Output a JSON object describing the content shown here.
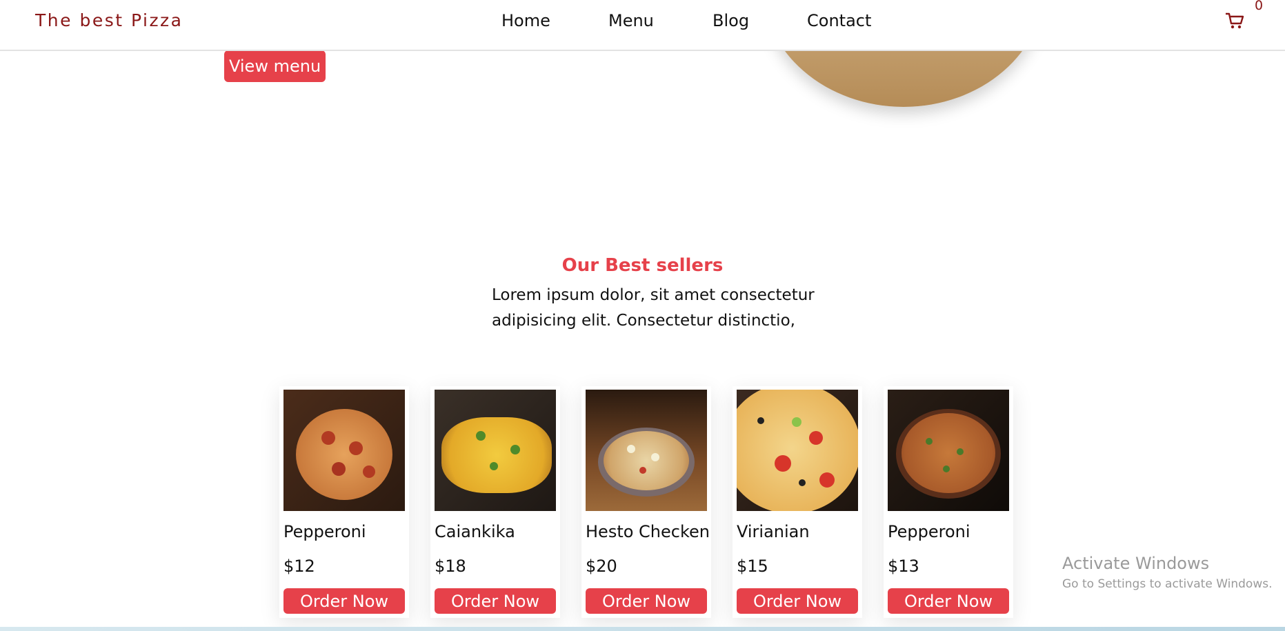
{
  "header": {
    "brand": "The best Pizza",
    "nav": [
      "Home",
      "Menu",
      "Blog",
      "Contact"
    ],
    "cart_count": "0"
  },
  "hero": {
    "view_menu": "View menu"
  },
  "best_sellers": {
    "title": "Our Best sellers",
    "description_line1": "Lorem ipsum dolor, sit amet consectetur",
    "description_line2": "adipisicing elit. Consectetur distinctio,",
    "items": [
      {
        "name": "Pepperoni",
        "price": "$12",
        "button": "Order Now"
      },
      {
        "name": "Caiankika",
        "price": "$18",
        "button": "Order Now"
      },
      {
        "name": "Hesto Checken",
        "price": "$20",
        "button": "Order Now"
      },
      {
        "name": "Virianian",
        "price": "$15",
        "button": "Order Now"
      },
      {
        "name": "Pepperoni",
        "price": "$13",
        "button": "Order Now"
      }
    ]
  },
  "watermark": {
    "line1": "Activate Windows",
    "line2": "Go to Settings to activate Windows."
  },
  "colors": {
    "accent": "#e6414a",
    "brand": "#8a1717"
  }
}
